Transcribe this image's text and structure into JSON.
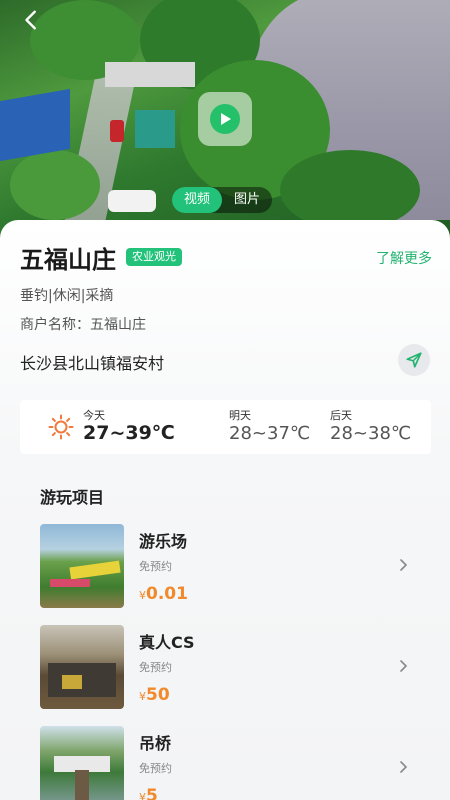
{
  "media": {
    "tabs": [
      {
        "label": "视频",
        "active": true
      },
      {
        "label": "图片",
        "active": false
      }
    ]
  },
  "place": {
    "name": "五福山庄",
    "tag": "农业观光",
    "learn_more": "了解更多",
    "categories": "垂钓|休闲|采摘",
    "merchant_label": "商户名称：",
    "merchant_name": "五福山庄",
    "address": "长沙县北山镇福安村"
  },
  "weather": {
    "today_label": "今天",
    "today_temp": "27~39℃",
    "tomorrow_label": "明天",
    "tomorrow_temp": "28~37℃",
    "day_after_label": "后天",
    "day_after_temp": "28~38℃"
  },
  "activities": {
    "title": "游玩项目",
    "items": [
      {
        "name": "游乐场",
        "sub": "免预约",
        "currency": "¥",
        "price": "0.01"
      },
      {
        "name": "真人CS",
        "sub": "免预约",
        "currency": "¥",
        "price": "50"
      },
      {
        "name": "吊桥",
        "sub": "免预约",
        "currency": "¥",
        "price": "5"
      }
    ]
  },
  "colors": {
    "accent": "#22c27a",
    "price": "#f08a2c",
    "sun": "#f07a3a"
  },
  "icons": [
    "back-icon",
    "play-icon",
    "navigate-icon",
    "sun-icon",
    "chevron-right-icon"
  ]
}
